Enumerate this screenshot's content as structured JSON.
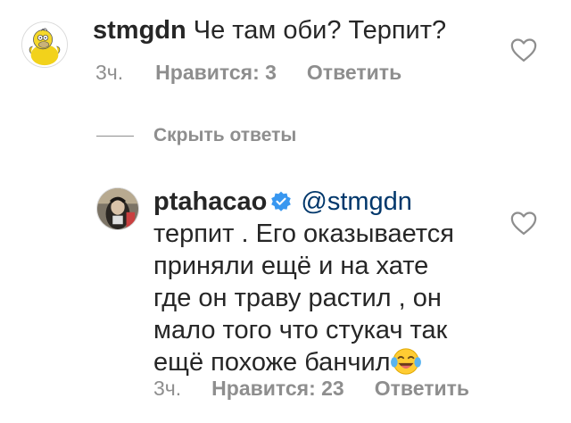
{
  "comment": {
    "username": "stmgdn",
    "text": "Че там оби? Терпит?",
    "time": "3ч.",
    "likes": "Нравится: 3",
    "reply": "Ответить"
  },
  "replies_toggle": {
    "label": "Скрыть ответы"
  },
  "reply_comment": {
    "username": "ptahacao",
    "mention": "@stmgdn",
    "lines": [
      "терпит . Его оказывается",
      "приняли ещё и на хате",
      "где он траву растил , он",
      "мало того что стукач так",
      "ещё похоже банчил"
    ],
    "time": "3ч.",
    "likes": "Нравится: 23",
    "reply": "Ответить"
  },
  "colors": {
    "text": "#262626",
    "meta": "#8e8e8e",
    "mention": "#00376b",
    "verified": "#3897f0"
  },
  "icons": {
    "like": "heart-outline-icon",
    "verified": "verified-badge-icon",
    "emoji": "face-with-tears-of-joy-emoji"
  }
}
